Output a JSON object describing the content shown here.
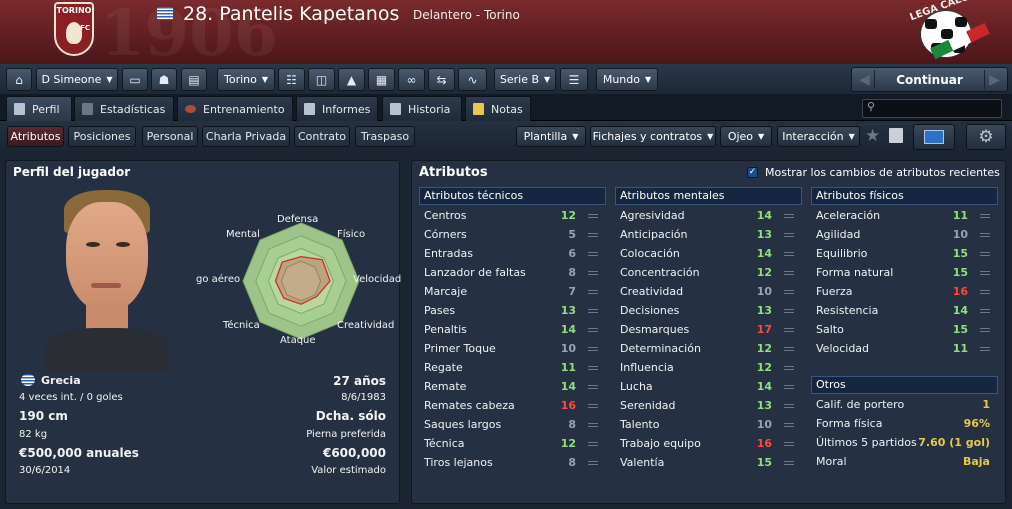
{
  "header": {
    "crest_text": "TORINO",
    "crest_fc": "FC",
    "bg_year": "1906",
    "player_title": "28. Pantelis Kapetanos",
    "player_subtitle": "Delantero - Torino",
    "lega_text": "LEGA CALCIO"
  },
  "toolbar": {
    "manager": "D Simeone",
    "club": "Torino",
    "league": "Serie B",
    "world": "Mundo",
    "continue": "Continuar"
  },
  "tabs": [
    {
      "label": "Perfil"
    },
    {
      "label": "Estadísticas"
    },
    {
      "label": "Entrenamiento"
    },
    {
      "label": "Informes"
    },
    {
      "label": "Historia"
    },
    {
      "label": "Notas"
    }
  ],
  "search": {
    "placeholder": ""
  },
  "subtabs": [
    {
      "label": "Atributos"
    },
    {
      "label": "Posiciones"
    },
    {
      "label": "Personal"
    },
    {
      "label": "Charla Privada"
    },
    {
      "label": "Contrato"
    },
    {
      "label": "Traspaso"
    }
  ],
  "actions": [
    {
      "label": "Plantilla"
    },
    {
      "label": "Fichajes y contratos"
    },
    {
      "label": "Ojeo"
    },
    {
      "label": "Interacción"
    }
  ],
  "profile": {
    "title": "Perfil del jugador",
    "nationality": "Grecia",
    "caps": "4 veces int. / 0 goles",
    "age": "27 años",
    "dob": "8/6/1983",
    "height": "190 cm",
    "foot": "Dcha. sólo",
    "weight": "82 kg",
    "foot_label": "Pierna preferida",
    "wage": "€500,000 anuales",
    "value": "€600,000",
    "contract_end": "30/6/2014",
    "value_label": "Valor estimado",
    "radar": {
      "labels": {
        "top": "Defensa",
        "tr": "Físico",
        "r": "Velocidad",
        "br": "Creatividad",
        "b": "Ataque",
        "bl": "Técnica",
        "l": "go aéreo",
        "tl": "Mental"
      },
      "values": [
        0.42,
        0.52,
        0.5,
        0.38,
        0.4,
        0.42,
        0.44,
        0.46
      ]
    }
  },
  "attributes": {
    "title": "Atributos",
    "toggle_label": "Mostrar los cambios de atributos recientes",
    "toggle_checked": true,
    "technical": {
      "header": "Atributos técnicos",
      "rows": [
        {
          "name": "Centros",
          "value": "12",
          "color": "#8fe07a"
        },
        {
          "name": "Córners",
          "value": "5",
          "color": "#9aa3ae"
        },
        {
          "name": "Entradas",
          "value": "6",
          "color": "#9aa3ae"
        },
        {
          "name": "Lanzador de faltas",
          "value": "8",
          "color": "#9aa3ae"
        },
        {
          "name": "Marcaje",
          "value": "7",
          "color": "#9aa3ae"
        },
        {
          "name": "Pases",
          "value": "13",
          "color": "#8fe07a"
        },
        {
          "name": "Penaltis",
          "value": "14",
          "color": "#8fe07a"
        },
        {
          "name": "Primer Toque",
          "value": "10",
          "color": "#9aa3ae"
        },
        {
          "name": "Regate",
          "value": "11",
          "color": "#8fe07a"
        },
        {
          "name": "Remate",
          "value": "14",
          "color": "#8fe07a"
        },
        {
          "name": "Remates cabeza",
          "value": "16",
          "color": "#ff4a3a"
        },
        {
          "name": "Saques largos",
          "value": "8",
          "color": "#9aa3ae"
        },
        {
          "name": "Técnica",
          "value": "12",
          "color": "#8fe07a"
        },
        {
          "name": "Tiros lejanos",
          "value": "8",
          "color": "#9aa3ae"
        }
      ]
    },
    "mental": {
      "header": "Atributos mentales",
      "rows": [
        {
          "name": "Agresividad",
          "value": "14",
          "color": "#8fe07a"
        },
        {
          "name": "Anticipación",
          "value": "13",
          "color": "#8fe07a"
        },
        {
          "name": "Colocación",
          "value": "14",
          "color": "#8fe07a"
        },
        {
          "name": "Concentración",
          "value": "12",
          "color": "#8fe07a"
        },
        {
          "name": "Creatividad",
          "value": "10",
          "color": "#9aa3ae"
        },
        {
          "name": "Decisiones",
          "value": "13",
          "color": "#8fe07a"
        },
        {
          "name": "Desmarques",
          "value": "17",
          "color": "#ff4a3a"
        },
        {
          "name": "Determinación",
          "value": "12",
          "color": "#8fe07a"
        },
        {
          "name": "Influencia",
          "value": "12",
          "color": "#8fe07a"
        },
        {
          "name": "Lucha",
          "value": "14",
          "color": "#8fe07a"
        },
        {
          "name": "Serenidad",
          "value": "13",
          "color": "#8fe07a"
        },
        {
          "name": "Talento",
          "value": "10",
          "color": "#9aa3ae"
        },
        {
          "name": "Trabajo equipo",
          "value": "16",
          "color": "#ff4a3a"
        },
        {
          "name": "Valentía",
          "value": "15",
          "color": "#8fe07a"
        }
      ]
    },
    "physical": {
      "header": "Atributos físicos",
      "rows": [
        {
          "name": "Aceleración",
          "value": "11",
          "color": "#8fe07a"
        },
        {
          "name": "Agilidad",
          "value": "10",
          "color": "#9aa3ae"
        },
        {
          "name": "Equilibrio",
          "value": "15",
          "color": "#8fe07a"
        },
        {
          "name": "Forma natural",
          "value": "15",
          "color": "#8fe07a"
        },
        {
          "name": "Fuerza",
          "value": "16",
          "color": "#ff4a3a"
        },
        {
          "name": "Resistencia",
          "value": "14",
          "color": "#8fe07a"
        },
        {
          "name": "Salto",
          "value": "15",
          "color": "#8fe07a"
        },
        {
          "name": "Velocidad",
          "value": "11",
          "color": "#8fe07a"
        }
      ]
    },
    "others": {
      "header": "Otros",
      "rows": [
        {
          "name": "Calif. de portero",
          "value": "1",
          "color": "#e8c84a"
        },
        {
          "name": "Forma física",
          "value": "96%",
          "color": "#e8c84a"
        },
        {
          "name": "Últimos 5 partidos",
          "value": "7.60 (1 gol)",
          "color": "#e8c84a"
        },
        {
          "name": "Moral",
          "value": "Baja",
          "color": "#e8c84a"
        }
      ]
    }
  }
}
